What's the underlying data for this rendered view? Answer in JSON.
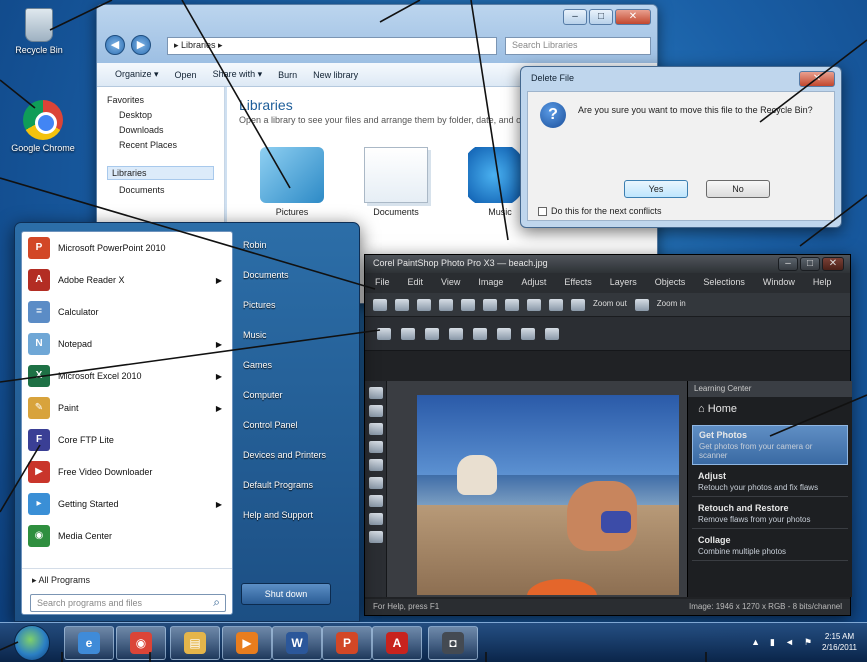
{
  "desktop": {
    "recycle_label": "Recycle Bin",
    "chrome_label": "Google Chrome"
  },
  "explorer": {
    "address": "▸ Libraries ▸",
    "search_placeholder": "Search Libraries",
    "toolbar": [
      "Organize ▾",
      "Open",
      "Share with ▾",
      "Burn",
      "New library"
    ],
    "nav": {
      "favorites": "Favorites",
      "favorites_items": [
        "Desktop",
        "Downloads",
        "Recent Places"
      ],
      "libraries": "Libraries",
      "libraries_items": [
        "Documents"
      ]
    },
    "title": "Libraries",
    "subtitle": "Open a library to see your files and arrange them by folder, date, and other properties.",
    "tiles": [
      "Documents",
      "Music",
      "Pictures"
    ]
  },
  "dialog": {
    "title": "Delete File",
    "message": "Are you sure you want to move this file to the Recycle Bin?",
    "yes": "Yes",
    "no": "No",
    "checkbox": "Do this for the next conflicts"
  },
  "start_menu": {
    "programs": [
      {
        "label": "Microsoft PowerPoint 2010",
        "icon_color": "#d24726",
        "glyph": "P",
        "arrow": false
      },
      {
        "label": "Adobe Reader X",
        "icon_color": "#b32d23",
        "glyph": "A",
        "arrow": true
      },
      {
        "label": "Calculator",
        "icon_color": "#5b8cc6",
        "glyph": "=",
        "arrow": false
      },
      {
        "label": "Notepad",
        "icon_color": "#6fa7d6",
        "glyph": "N",
        "arrow": true
      },
      {
        "label": "Microsoft Excel 2010",
        "icon_color": "#1e7145",
        "glyph": "X",
        "arrow": true
      },
      {
        "label": "Paint",
        "icon_color": "#d8a33c",
        "glyph": "✎",
        "arrow": true
      },
      {
        "label": "Core FTP Lite",
        "icon_color": "#3a3f95",
        "glyph": "F",
        "arrow": false
      },
      {
        "label": "Free Video Downloader",
        "icon_color": "#c9352b",
        "glyph": "▶",
        "arrow": false
      },
      {
        "label": "Getting Started",
        "icon_color": "#3a8fd6",
        "glyph": "▸",
        "arrow": true
      },
      {
        "label": "Media Center",
        "icon_color": "#2f8f3f",
        "glyph": "◉",
        "arrow": false
      }
    ],
    "all_programs": "All Programs",
    "search_placeholder": "Search programs and files",
    "right_items": [
      "Robin",
      "Documents",
      "Pictures",
      "Music",
      "Games",
      "Computer",
      "Control Panel",
      "Devices and Printers",
      "Default Programs",
      "Help and Support"
    ],
    "shutdown": "Shut down"
  },
  "photo_app": {
    "title": "Corel PaintShop Photo Pro X3 — beach.jpg",
    "menu": [
      "File",
      "Edit",
      "View",
      "Image",
      "Adjust",
      "Effects",
      "Layers",
      "Objects",
      "Selections",
      "Window",
      "Help"
    ],
    "toolbar_text": [
      "Zoom out",
      "Zoom in"
    ],
    "learning_center_title": "Learning Center",
    "home_label": "Home",
    "learn_items": [
      {
        "title": "Get Photos",
        "desc": "Get photos from your camera or scanner",
        "selected": true
      },
      {
        "title": "Adjust",
        "desc": "Retouch your photos and fix flaws",
        "selected": false
      },
      {
        "title": "Retouch and Restore",
        "desc": "Remove flaws from your photos",
        "selected": false
      },
      {
        "title": "Collage",
        "desc": "Combine multiple photos",
        "selected": false
      }
    ],
    "status_left": "For Help, press F1",
    "status_right": "Image: 1946 x 1270 x RGB - 8 bits/channel"
  },
  "taskbar": {
    "buttons": [
      {
        "name": "ie",
        "color": "#3f8bd8",
        "glyph": "e"
      },
      {
        "name": "chrome",
        "color": "#db4437",
        "glyph": "◉"
      },
      {
        "name": "explorer",
        "color": "#e5b54a",
        "glyph": "▤"
      },
      {
        "name": "media-player",
        "color": "#e87d1e",
        "glyph": "▶"
      },
      {
        "name": "word",
        "color": "#2b579a",
        "glyph": "W"
      },
      {
        "name": "powerpoint",
        "color": "#d24726",
        "glyph": "P"
      },
      {
        "name": "acrobat",
        "color": "#c8231e",
        "glyph": "A"
      },
      {
        "name": "camera",
        "color": "#444a52",
        "glyph": "◘"
      }
    ],
    "time": "2:15 AM",
    "date": "2/16/2011"
  },
  "colors": {
    "desktop_bg": "#1a5fa6",
    "accent": "#2e6fb3"
  }
}
